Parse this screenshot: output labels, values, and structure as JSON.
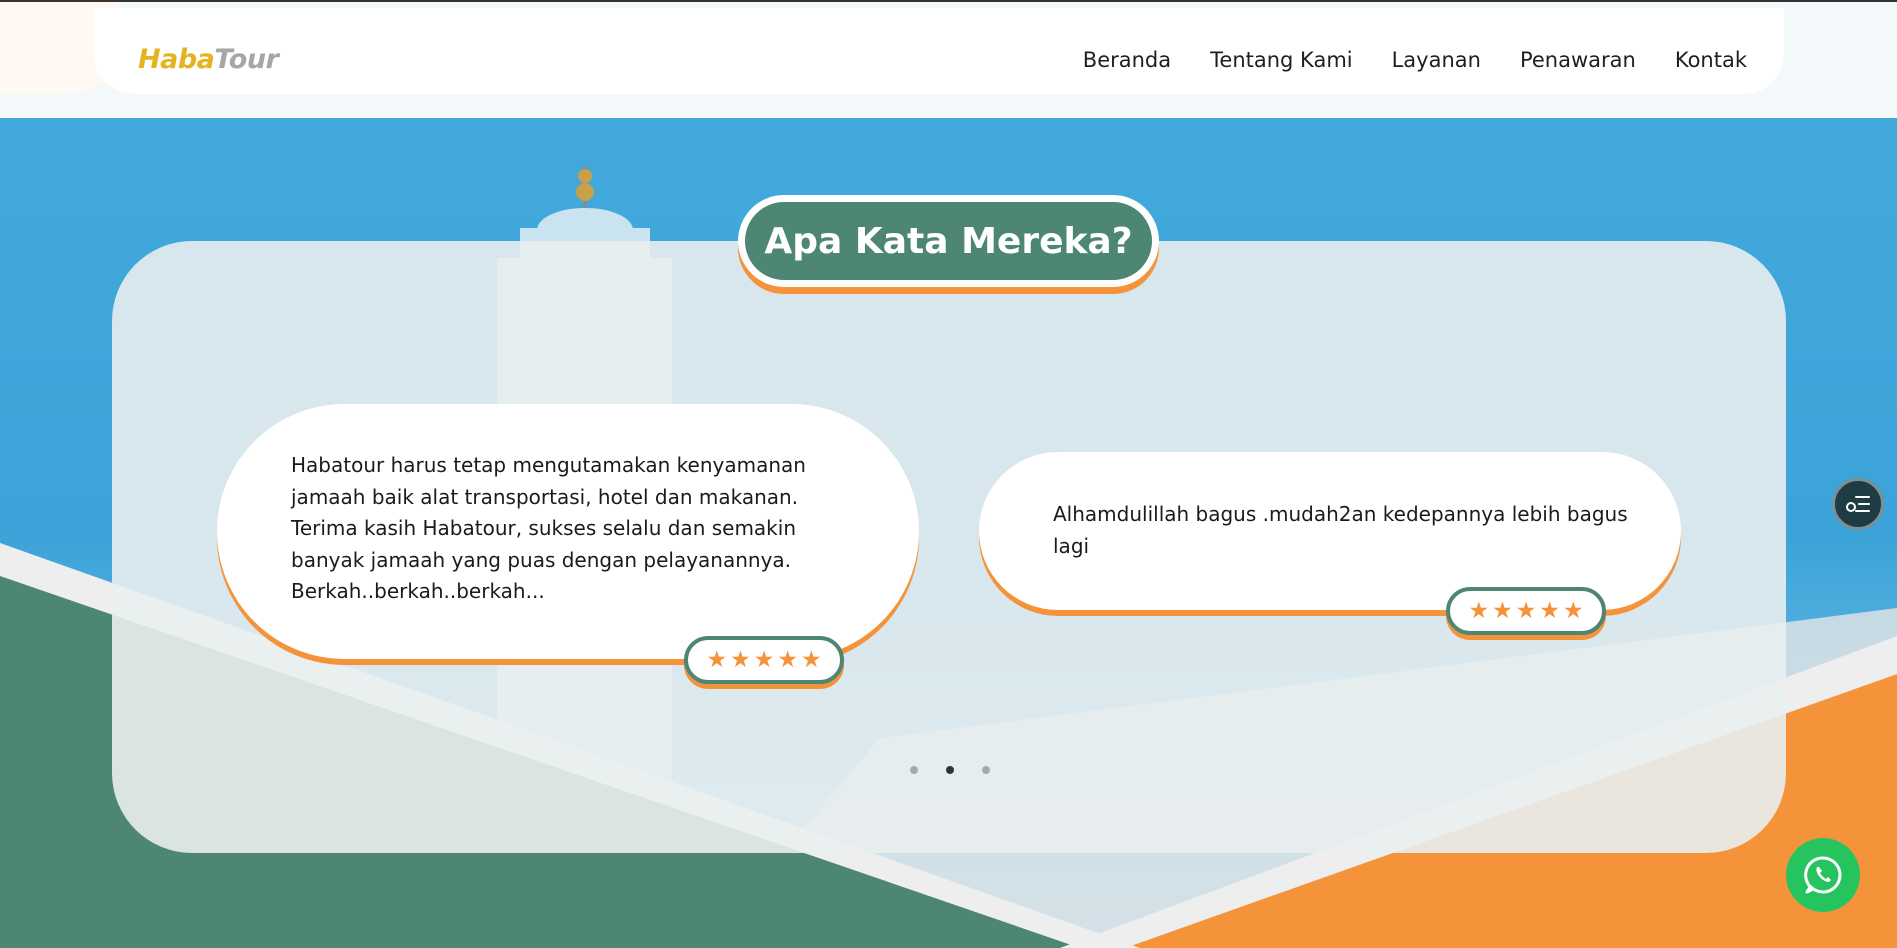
{
  "brand": {
    "part1": "Haba",
    "part2": "Tour"
  },
  "nav": [
    "Beranda",
    "Tentang Kami",
    "Layanan",
    "Penawaran",
    "Kontak"
  ],
  "section": {
    "title": "Apa Kata Mereka?"
  },
  "testimonials": [
    {
      "text": "Habatour harus tetap mengutamakan kenyamanan jamaah baik alat transportasi, hotel dan makanan. Terima kasih Habatour, sukses selalu dan semakin banyak jamaah yang puas dengan pelayanannya. Berkah..berkah..berkah...",
      "rating": 5
    },
    {
      "text": "Alhamdulillah bagus .mudah2an kedepannya lebih bagus lagi",
      "rating": 5
    }
  ],
  "carousel": {
    "total": 3,
    "active": 2
  },
  "icons": {
    "star": "star-icon",
    "side": "list-settings-icon",
    "whatsapp": "whatsapp-icon"
  },
  "colors": {
    "primary_green": "#4e8675",
    "accent_orange": "#f5933a",
    "logo_gold": "#e6b320",
    "whatsapp": "#25c45e"
  }
}
